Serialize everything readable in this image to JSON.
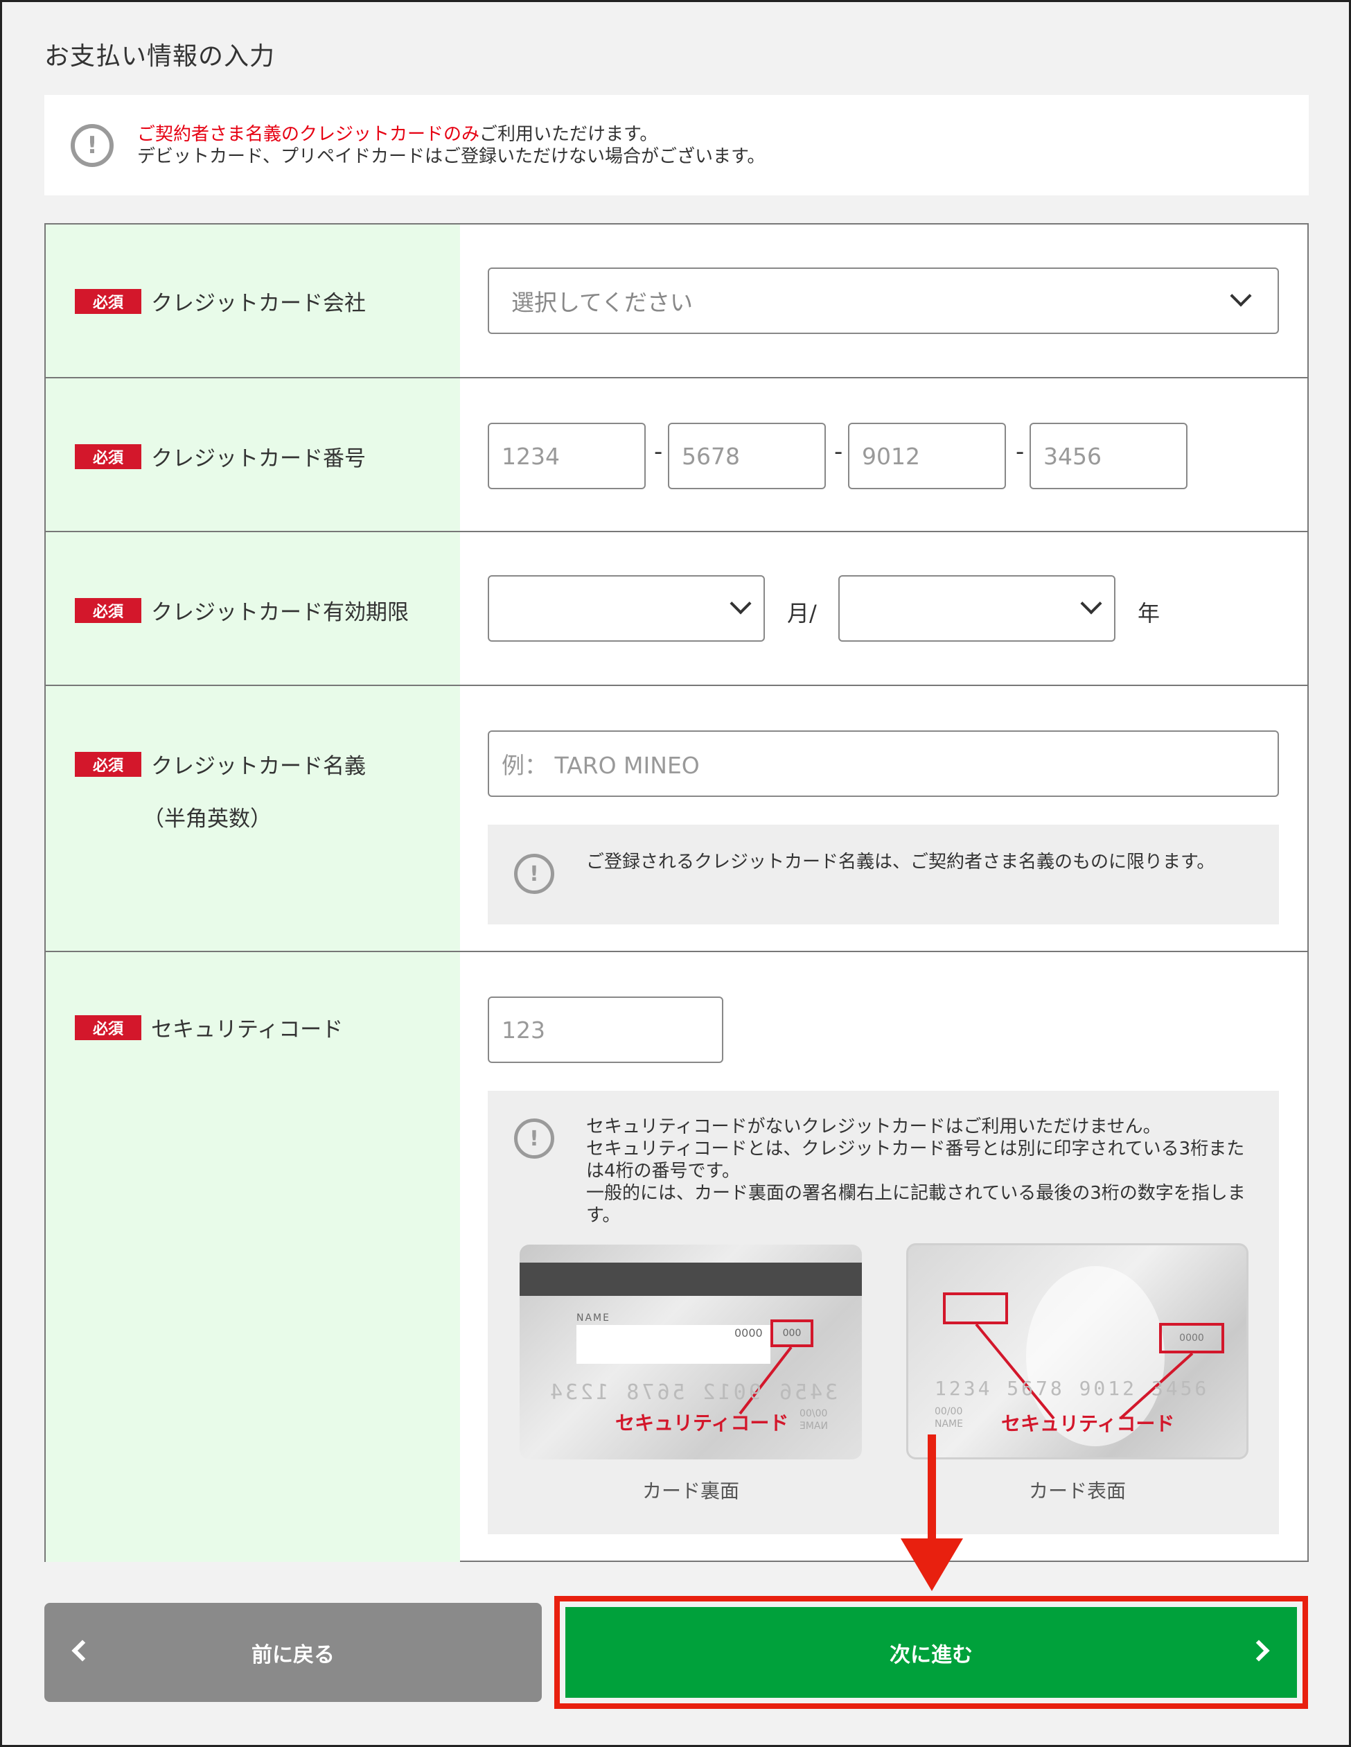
{
  "title": "お支払い情報の入力",
  "notice": {
    "red_text": "ご契約者さま名義のクレジットカードのみ",
    "text1": "ご利用いただけます。",
    "text2": "デビットカード、プリペイドカードはご登録いただけない場合がございます。"
  },
  "required_badge": "必須",
  "rows": {
    "company": {
      "label": "クレジットカード会社",
      "placeholder": "選択してください"
    },
    "number": {
      "label": "クレジットカード番号",
      "placeholders": [
        "1234",
        "5678",
        "9012",
        "3456"
      ],
      "separator": "-"
    },
    "expiry": {
      "label": "クレジットカード有効期限",
      "month_unit": "月/",
      "year_unit": "年",
      "month_value": "",
      "year_value": ""
    },
    "name": {
      "label": "クレジットカード名義",
      "sublabel": "（半角英数）",
      "placeholder": "例： TARO MINEO",
      "note": "ご登録されるクレジットカード名義は、ご契約者さま名義のものに限ります。"
    },
    "security": {
      "label": "セキュリティコード",
      "placeholder": "123",
      "note": [
        "セキュリティコードがないクレジットカードはご利用いただけません。",
        "セキュリティコードとは、クレジットカード番号とは別に印字されている3桁または4桁の番号です。",
        "一般的には、カード裏面の署名欄右上に記載されている最後の3桁の数字を指します。"
      ],
      "card_back": {
        "caption": "カード裏面",
        "name_text": "NAME",
        "digits4": "0000",
        "digits3": "000",
        "callout": "セキュリティコード",
        "number_text": "3456 9012 5678 1234",
        "date_text": "00/00",
        "name2": "NAME"
      },
      "card_front": {
        "caption": "カード表面",
        "digits4": "0000",
        "callout": "セキュリティコード",
        "number_text": "1234 5678 9012 3456",
        "date_text": "00/00",
        "name_text": "NAME"
      }
    }
  },
  "buttons": {
    "back": "前に戻る",
    "next": "次に進む"
  },
  "colors": {
    "required": "#d3172b",
    "next_button": "#00a13b",
    "highlight": "#e8200f",
    "label_bg": "#e8fbe9"
  }
}
